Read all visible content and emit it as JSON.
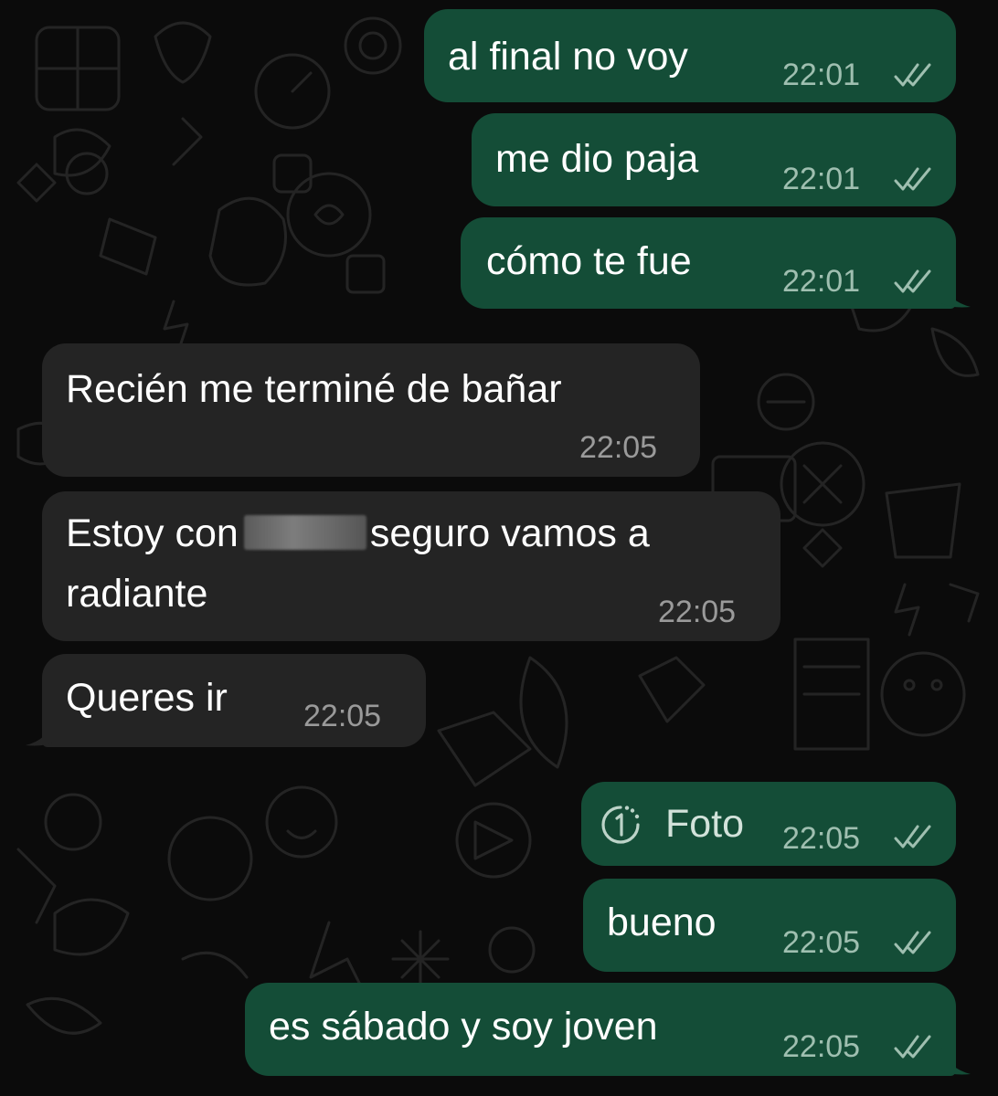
{
  "colors": {
    "outgoing_bubble": "#144d37",
    "incoming_bubble": "#242424",
    "background": "#0b0b0b",
    "read_ticks": "#9fbfb0"
  },
  "messages": [
    {
      "direction": "outgoing",
      "text": "al final no voy",
      "time": "22:01",
      "status_icon": "double-check-icon"
    },
    {
      "direction": "outgoing",
      "text": "me dio paja",
      "time": "22:01",
      "status_icon": "double-check-icon"
    },
    {
      "direction": "outgoing",
      "text": "cómo te fue",
      "time": "22:01",
      "status_icon": "double-check-icon"
    },
    {
      "direction": "incoming",
      "text": "Recién me terminé de bañar",
      "time": "22:05"
    },
    {
      "direction": "incoming",
      "text_before_redaction": "Estoy con",
      "text_after_redaction": "seguro vamos a",
      "text_line2": "radiante",
      "time": "22:05"
    },
    {
      "direction": "incoming",
      "text": "Queres ir",
      "time": "22:05"
    },
    {
      "direction": "outgoing",
      "type": "view-once-photo",
      "text": "Foto",
      "time": "22:05",
      "icon": "view-once-icon",
      "status_icon": "double-check-icon"
    },
    {
      "direction": "outgoing",
      "text": "bueno",
      "time": "22:05",
      "status_icon": "double-check-icon"
    },
    {
      "direction": "outgoing",
      "text": "es sábado y soy joven",
      "time": "22:05",
      "status_icon": "double-check-icon"
    }
  ]
}
